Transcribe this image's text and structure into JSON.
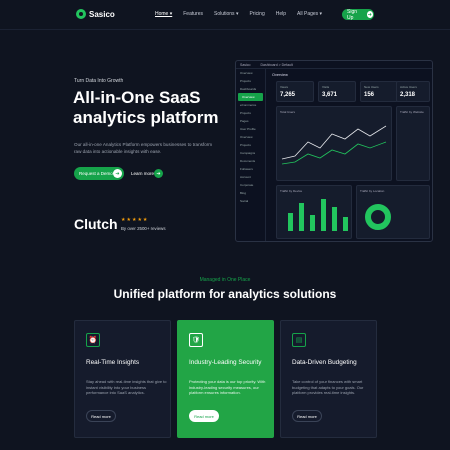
{
  "brand": {
    "name": "Sasico"
  },
  "nav": {
    "items": [
      "Home ▾",
      "Features",
      "Solutions ▾",
      "Pricing",
      "Help",
      "All Pages ▾"
    ],
    "cta": "Sign Up"
  },
  "hero": {
    "eyebrow": "Turn Data Into Growth",
    "title_line1": "All-in-One SaaS",
    "title_line2": "analytics platform",
    "description": "Our all-in-one Analytics Platform empowers businesses to transform raw data into actionable insights with ease.",
    "primary_cta": "Request a Demo",
    "secondary_cta": "Learn more",
    "clutch": "Clutch",
    "stars": "★★★★★",
    "reviews": "By over 2500+ reviews"
  },
  "dashboard": {
    "breadcrumb": "Sasico",
    "crumbs": "Dashboard  >  Default",
    "sidebar": [
      "Overview",
      "Projects",
      "Dashboards",
      "Overview",
      "eCommerce",
      "Projects",
      "Pages",
      "User Profile",
      "Overview",
      "Projects",
      "Campaigns",
      "Documents",
      "Followers",
      "Account",
      "Corporate",
      "Blog",
      "Social"
    ],
    "overview": "Overview",
    "stats": [
      {
        "label": "Views",
        "value": "7,265"
      },
      {
        "label": "Visits",
        "value": "3,671"
      },
      {
        "label": "New Users",
        "value": "156"
      },
      {
        "label": "Active Users",
        "value": "2,318"
      }
    ],
    "chart_title": "Total Users",
    "traffic_website": "Traffic by Website",
    "traffic_device": "Traffic by Device",
    "traffic_location": "Traffic by Location"
  },
  "section": {
    "tag": "Managed in One Place",
    "title": "Unified platform for analytics solutions"
  },
  "cards": [
    {
      "icon": "⏰",
      "title": "Real-Time Insights",
      "desc": "Stay ahead with real-time insights that give to instant visibility into your business performance into SaaS analytics.",
      "cta": "Read more"
    },
    {
      "icon": "🛡",
      "title": "Industry-Leading Security",
      "desc": "Protecting your data is our top priority. With industry-leading security measures, our platform ensures information.",
      "cta": "Read more"
    },
    {
      "icon": "▤",
      "title": "Data-Driven Budgeting",
      "desc": "Take control of your finances with smart budgeting that adapts to your goals. Our platform provides real-time insights.",
      "cta": "Read more"
    }
  ],
  "colors": {
    "accent": "#16a34a",
    "bg": "#0f1420"
  }
}
